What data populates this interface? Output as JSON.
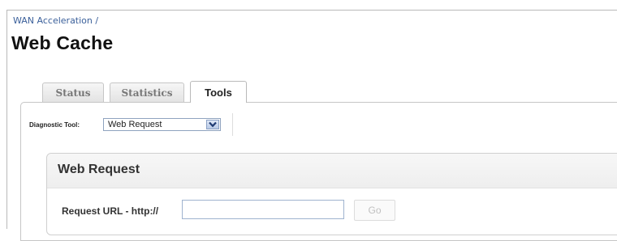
{
  "breadcrumb": {
    "path": "WAN Acceleration /"
  },
  "page": {
    "title": "Web Cache"
  },
  "tabs": [
    {
      "label": "Status",
      "active": false
    },
    {
      "label": "Statistics",
      "active": false
    },
    {
      "label": "Tools",
      "active": true
    }
  ],
  "diagnostic": {
    "label": "Diagnostic Tool:",
    "selected": "Web Request",
    "dropdown_icon": "chevron-down-icon"
  },
  "web_request": {
    "title": "Web Request",
    "url_label": "Request URL - http://",
    "url_value": "",
    "go_label": "Go"
  },
  "colors": {
    "breadcrumb": "#3a5f9a",
    "border": "#c6c6c6",
    "select_border": "#8fa3bf"
  }
}
